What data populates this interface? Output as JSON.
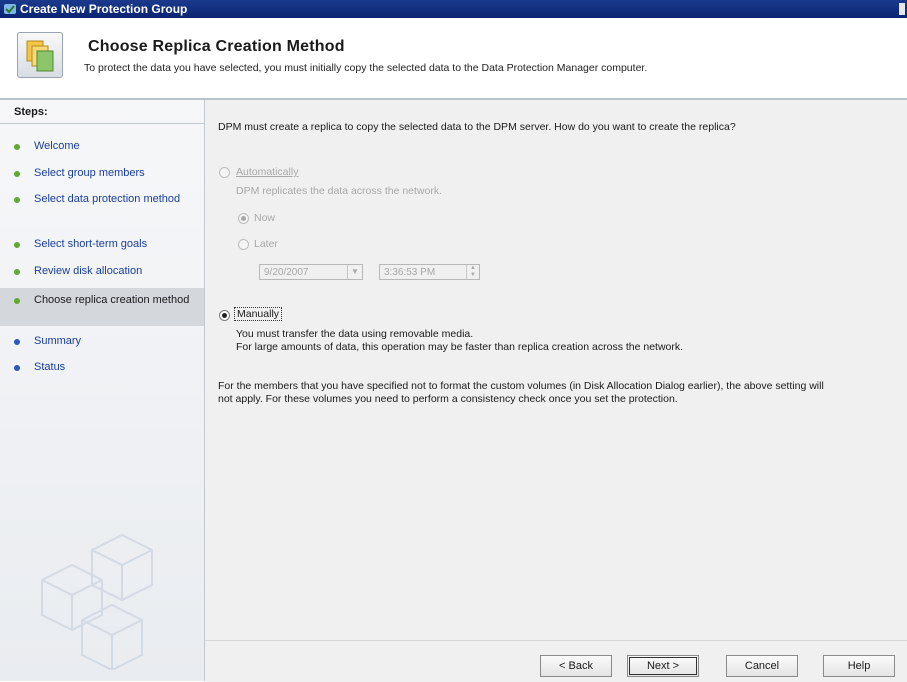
{
  "window": {
    "title": "Create New Protection Group"
  },
  "header": {
    "title": "Choose Replica Creation Method",
    "subtitle": "To protect the data you have selected, you must initially copy the selected data to the Data Protection Manager computer."
  },
  "sidebar": {
    "title": "Steps:",
    "items": [
      {
        "label": "Welcome"
      },
      {
        "label": "Select group members"
      },
      {
        "label": "Select data protection method"
      },
      {
        "label": "Select short-term goals"
      },
      {
        "label": "Review disk allocation"
      },
      {
        "label": "Choose replica creation method",
        "current": true
      },
      {
        "label": "Summary"
      },
      {
        "label": "Status"
      }
    ]
  },
  "main": {
    "question": "DPM must create a replica to copy the selected data to the DPM server. How do you want to create the replica?",
    "automatically": {
      "label": "Automatically",
      "description": "DPM replicates the data across the network.",
      "now_label": "Now",
      "later_label": "Later",
      "date": "9/20/2007",
      "time": "3:36:53 PM"
    },
    "manually": {
      "label": "Manually",
      "description_line1": "You must transfer the data using removable media.",
      "description_line2": "For large amounts of data, this operation may be faster than replica creation across the network."
    },
    "note": "For the members that you have specified not to format the custom volumes (in Disk Allocation Dialog earlier), the above setting will not apply. For these volumes you need to perform a consistency check once you set the protection."
  },
  "buttons": {
    "back": "< Back",
    "next": "Next >",
    "cancel": "Cancel",
    "help": "Help"
  },
  "colors": {
    "titlebar": "#0a2472",
    "step_bullet_done": "#5fa832",
    "step_bullet_pending": "#2a57b8",
    "current_step_bg": "#d4d7dc"
  }
}
